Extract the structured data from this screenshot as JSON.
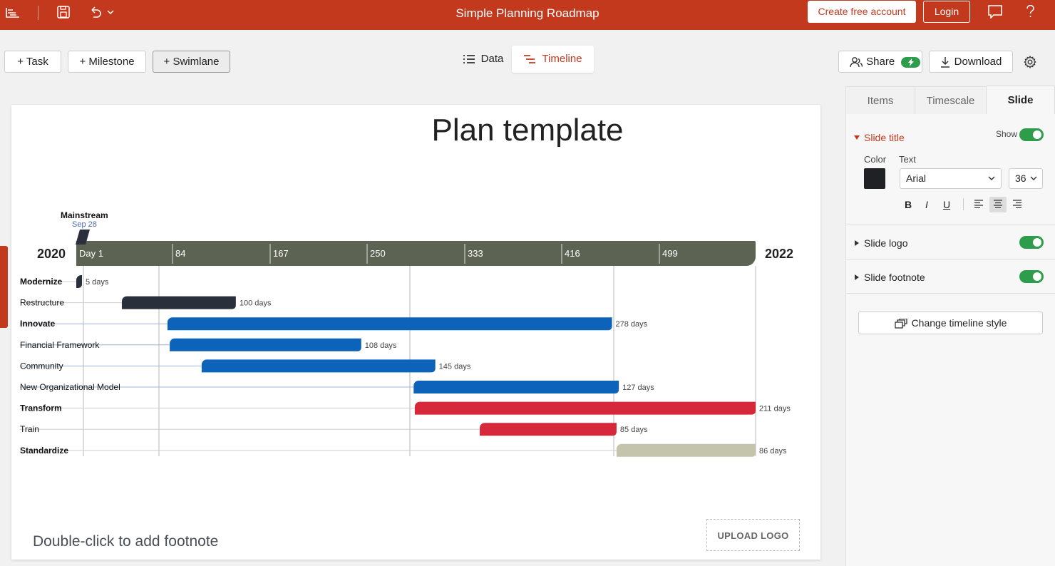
{
  "app": {
    "title": "Simple Planning Roadmap",
    "create_account": "Create free account",
    "login": "Login"
  },
  "toolbar": {
    "task": "+ Task",
    "milestone": "+ Milestone",
    "swimlane": "+ Swimlane",
    "data_view": "Data",
    "timeline_view": "Timeline",
    "share": "Share",
    "download": "Download"
  },
  "slide": {
    "title": "Plan template",
    "footnote": "Double-click to add footnote",
    "upload_logo": "UPLOAD LOGO"
  },
  "timeline": {
    "start_year": "2020",
    "end_year": "2022",
    "ticks": [
      "Day 1",
      "84",
      "167",
      "250",
      "333",
      "416",
      "499"
    ],
    "milestone": {
      "name": "Mainstream",
      "date": "Sep 28"
    },
    "tasks": [
      {
        "name": "Modernize",
        "bold": true,
        "label": "5 days",
        "start": 0,
        "end": 5,
        "color": "#2a2f3c"
      },
      {
        "name": "Restructure",
        "bold": false,
        "label": "100 days",
        "start": 40,
        "end": 140,
        "color": "#2a2f3c"
      },
      {
        "name": "Innovate",
        "bold": true,
        "label": "278 days",
        "start": 80,
        "end": 470,
        "color": "#0d62b9"
      },
      {
        "name": "Financial Framework",
        "bold": false,
        "label": "108 days",
        "start": 82,
        "end": 250,
        "color": "#0d62b9"
      },
      {
        "name": "Community",
        "bold": false,
        "label": "145 days",
        "start": 110,
        "end": 315,
        "color": "#0d62b9"
      },
      {
        "name": "New Organizational Model",
        "bold": false,
        "label": "127 days",
        "start": 296,
        "end": 476,
        "color": "#0d62b9"
      },
      {
        "name": "Transform",
        "bold": true,
        "label": "211 days",
        "start": 297,
        "end": 596,
        "color": "#d7283b"
      },
      {
        "name": "Train",
        "bold": false,
        "label": "85 days",
        "start": 354,
        "end": 474,
        "color": "#d7283b"
      },
      {
        "name": "Standardize",
        "bold": true,
        "label": "86 days",
        "start": 474,
        "end": 596,
        "color": "#c4c3ab"
      }
    ]
  },
  "panel": {
    "tabs": [
      "Items",
      "Timescale",
      "Slide"
    ],
    "slide_title_section": "Slide title",
    "show": "Show",
    "color_label": "Color",
    "text_label": "Text",
    "font": "Arial",
    "font_size": "36",
    "bold": "B",
    "italic": "I",
    "underline": "U",
    "slide_logo": "Slide logo",
    "slide_footnote": "Slide footnote",
    "change_style": "Change timeline style",
    "title_color": "#1f2124"
  }
}
